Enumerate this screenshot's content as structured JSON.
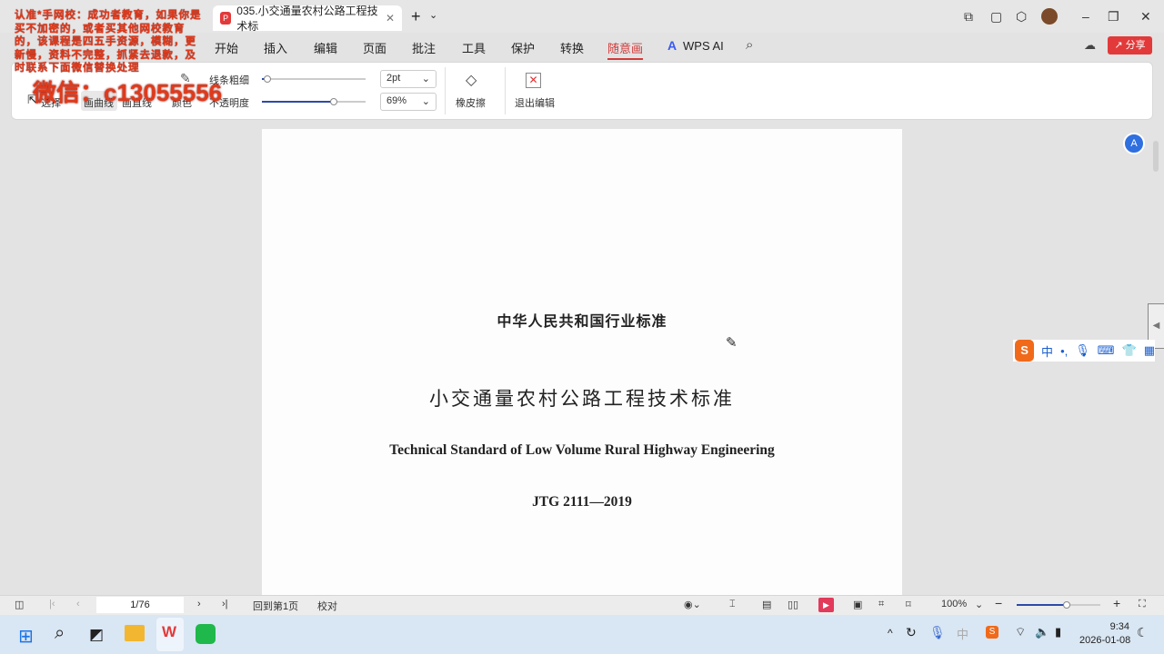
{
  "watermark": {
    "notice": "认准*手网校：成功者教育，如果你是买不加密的，或者买其他网校教育的，该课程是四五手资源，模糊，更新慢，资料不完整，抓紧去退款，及时联系下面微信替换处理",
    "wechat": "微信：c13055556"
  },
  "tab": {
    "title": "035.小交通量农村公路工程技术标",
    "close": "✕",
    "new": "+",
    "new_dropdown": "⌄"
  },
  "window": {
    "minimize": "–",
    "restore": "❐",
    "close": "✕"
  },
  "menu": [
    "开始",
    "插入",
    "编辑",
    "页面",
    "批注",
    "工具",
    "保护",
    "转换",
    "随意画"
  ],
  "wps_ai": "WPS AI",
  "share": "分享",
  "ribbon": {
    "select": "选择",
    "curve": "画曲线",
    "line": "画直线",
    "color": "颜色",
    "thickness_label": "线条粗细",
    "thickness_value": "2pt",
    "thickness_fraction": 0.05,
    "opacity_label": "不透明度",
    "opacity_value": "69%",
    "opacity_fraction": 0.69,
    "eraser": "橡皮擦",
    "exit": "退出编辑"
  },
  "document": {
    "header": "中华人民共和国行业标准",
    "title_cn": "小交通量农村公路工程技术标准",
    "title_en": "Technical Standard of Low Volume Rural Highway Engineering",
    "code": "JTG 2111—2019"
  },
  "status": {
    "page": "1/76",
    "back_to_first": "回到第1页",
    "proofread": "校对",
    "zoom": "100%",
    "zoom_fraction": 0.6
  },
  "ime": {
    "mode": "中",
    "punct": "•,"
  },
  "taskbar": {
    "time": "9:34",
    "date": "2026-01-08"
  }
}
